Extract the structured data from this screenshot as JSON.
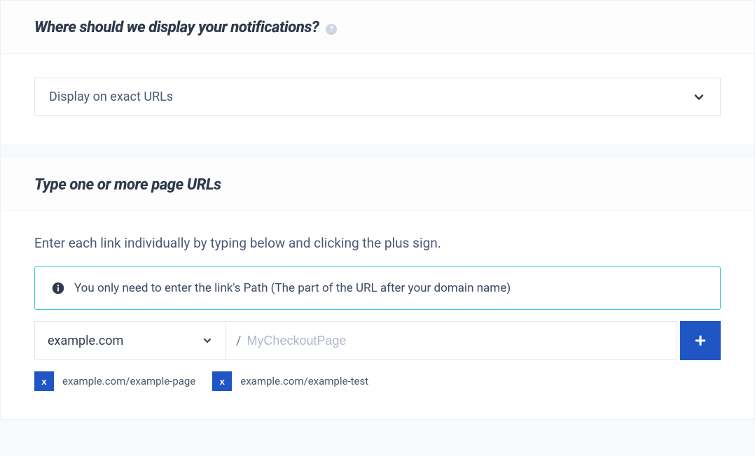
{
  "section1": {
    "heading": "Where should we display your notifications?",
    "help_symbol": "?",
    "select_value": "Display on exact URLs"
  },
  "section2": {
    "heading": "Type one or more page URLs",
    "instruction": "Enter each link individually by typing below and clicking the plus sign.",
    "info_text": "You only need to enter the link's Path (The part of the URL after your domain name)",
    "domain_value": "example.com",
    "path_separator": "/",
    "path_placeholder": "MyCheckoutPage",
    "add_symbol": "+",
    "tags": [
      {
        "remove": "x",
        "label": "example.com/example-page"
      },
      {
        "remove": "x",
        "label": "example.com/example-test"
      }
    ]
  }
}
